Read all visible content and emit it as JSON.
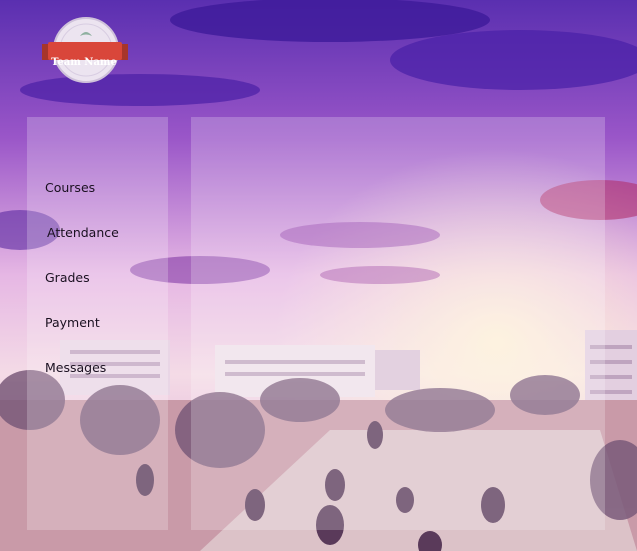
{
  "logo": {
    "text": "Team Name"
  },
  "sidebar": {
    "items": [
      {
        "label": "Courses"
      },
      {
        "label": "Attendance"
      },
      {
        "label": "Grades"
      },
      {
        "label": "Payment"
      },
      {
        "label": "Messages"
      }
    ]
  },
  "colors": {
    "sky_top": "#5a2fb0",
    "sky_mid": "#c98ad8",
    "ribbon": "#d9463a",
    "panel_overlay": "#ffffff"
  }
}
